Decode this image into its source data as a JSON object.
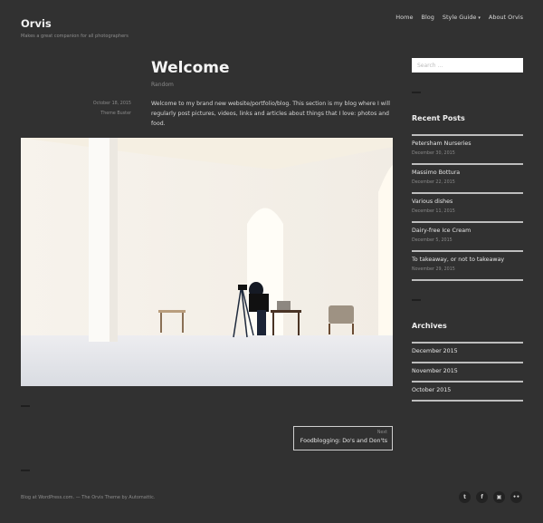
{
  "site": {
    "title": "Orvis",
    "description": "Makes a great companion for all photographers"
  },
  "nav": {
    "items": [
      "Home",
      "Blog",
      "Style Guide",
      "About Orvis"
    ],
    "dropdown_indicator": "⌄"
  },
  "post": {
    "title": "Welcome",
    "category": "Random",
    "date": "October 18, 2015",
    "author": "Theme Buster",
    "body": "Welcome to my brand new website/portfolio/blog. This section is my blog where I will regularly post pictures, videos, links and articles about things that I love: photos and food.",
    "image_alt": "Photographer with tripod in a large white room with arches"
  },
  "post_nav": {
    "next_label": "Next",
    "next_title": "Foodblogging: Do's and Don'ts"
  },
  "sidebar": {
    "search_placeholder": "Search ...",
    "recent_posts": {
      "title": "Recent Posts",
      "items": [
        {
          "title": "Petersham Nurseries",
          "date": "December 30, 2015"
        },
        {
          "title": "Massimo Bottura",
          "date": "December 22, 2015"
        },
        {
          "title": "Various dishes",
          "date": "December 11, 2015"
        },
        {
          "title": "Dairy-free Ice Cream",
          "date": "December 5, 2015"
        },
        {
          "title": "To takeaway, or not to takeaway",
          "date": "November 29, 2015"
        }
      ]
    },
    "archives": {
      "title": "Archives",
      "items": [
        "December 2015",
        "November 2015",
        "October 2015"
      ]
    }
  },
  "footer": {
    "credit": "Blog at WordPress.com. — The Orvis Theme by Automattic.",
    "social": [
      {
        "name": "twitter-icon",
        "glyph": "t"
      },
      {
        "name": "facebook-icon",
        "glyph": "f"
      },
      {
        "name": "instagram-icon",
        "glyph": "▣"
      },
      {
        "name": "flickr-icon",
        "glyph": "••"
      }
    ]
  }
}
